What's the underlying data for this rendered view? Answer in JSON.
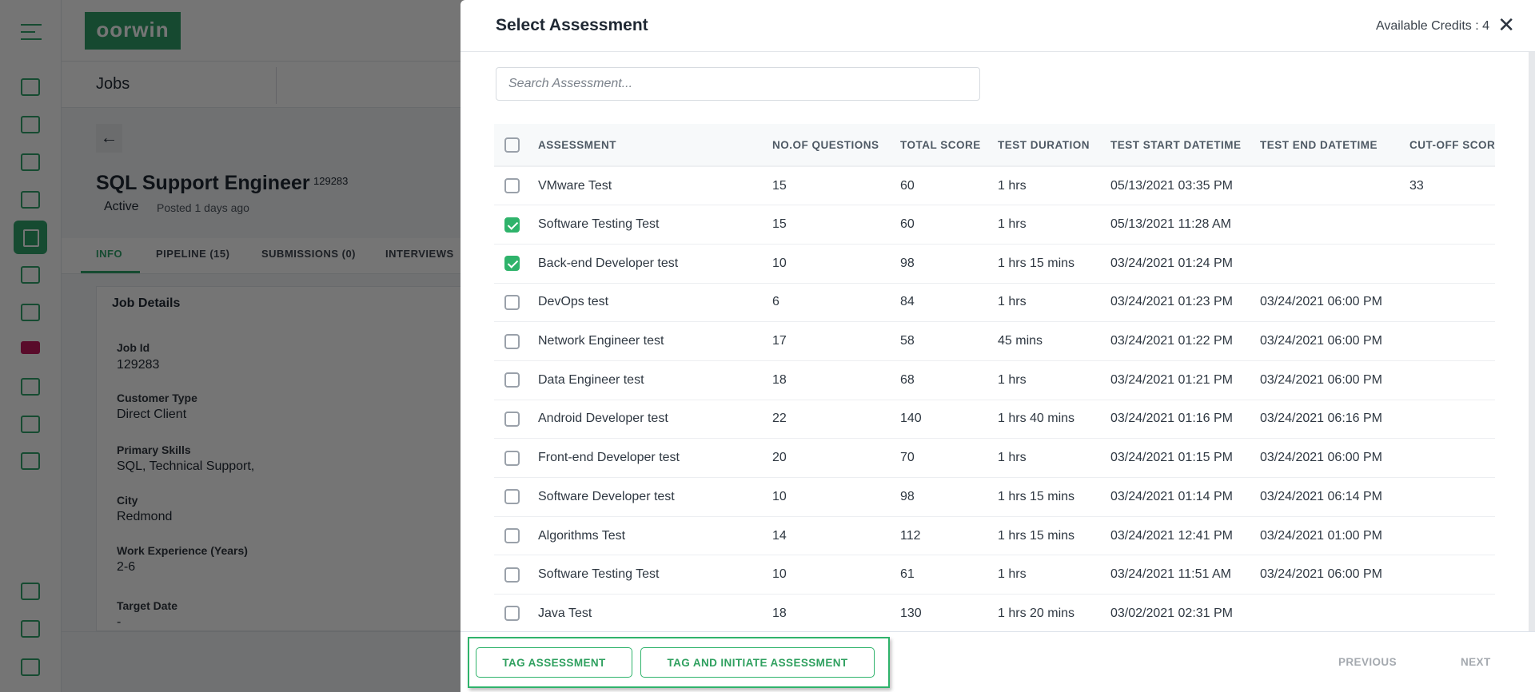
{
  "app": {
    "logo_text": "oorwin",
    "section_title": "Jobs"
  },
  "sidebar": {
    "icons": [
      "dashboard-icon",
      "contacts-icon",
      "calls-icon",
      "briefcase-icon",
      "jobs-icon",
      "candidates-icon",
      "submissions-icon",
      "beta-icon",
      "reports-icon",
      "workflow-icon",
      "documents-icon"
    ],
    "bottom_icons": [
      "settings-sliders-icon",
      "headset-icon",
      "help-icon"
    ],
    "active": "jobs-icon",
    "accent": "#2fa36b"
  },
  "job": {
    "title": "SQL Support Engineer",
    "id": "129283",
    "status": "Active",
    "posted": "Posted 1 days ago",
    "tabs": [
      "INFO",
      "PIPELINE (15)",
      "SUBMISSIONS (0)",
      "INTERVIEWS"
    ],
    "card_title": "Job Details",
    "fields": [
      {
        "label": "Job Id",
        "value": "129283"
      },
      {
        "label": "Customer Type",
        "value": "Direct Client"
      },
      {
        "label": "Primary Skills",
        "value": "SQL, Technical Support,"
      },
      {
        "label": "City",
        "value": "Redmond"
      },
      {
        "label": "Work Experience (Years)",
        "value": "2-6"
      },
      {
        "label": "Target Date",
        "value": "-"
      }
    ]
  },
  "modal": {
    "title": "Select Assessment",
    "credits": "Available Credits : 4",
    "search_placeholder": "Search Assessment...",
    "columns": [
      "ASSESSMENT",
      "NO.OF QUESTIONS",
      "TOTAL SCORE",
      "TEST DURATION",
      "TEST START DATETIME",
      "TEST END DATETIME",
      "CUT-OFF SCORE"
    ],
    "rows": [
      {
        "checked": false,
        "name": "VMware Test",
        "questions": "15",
        "score": "60",
        "duration": "1 hrs",
        "start": "05/13/2021 03:35 PM",
        "end": "",
        "cutoff": "33"
      },
      {
        "checked": true,
        "name": "Software Testing Test",
        "questions": "15",
        "score": "60",
        "duration": "1 hrs",
        "start": "05/13/2021 11:28 AM",
        "end": "",
        "cutoff": ""
      },
      {
        "checked": true,
        "name": "Back-end Developer test",
        "questions": "10",
        "score": "98",
        "duration": "1 hrs 15 mins",
        "start": "03/24/2021 01:24 PM",
        "end": "",
        "cutoff": ""
      },
      {
        "checked": false,
        "name": "DevOps test",
        "questions": "6",
        "score": "84",
        "duration": "1 hrs",
        "start": "03/24/2021 01:23 PM",
        "end": "03/24/2021 06:00 PM",
        "cutoff": ""
      },
      {
        "checked": false,
        "name": "Network Engineer test",
        "questions": "17",
        "score": "58",
        "duration": "45 mins",
        "start": "03/24/2021 01:22 PM",
        "end": "03/24/2021 06:00 PM",
        "cutoff": ""
      },
      {
        "checked": false,
        "name": "Data Engineer test",
        "questions": "18",
        "score": "68",
        "duration": "1 hrs",
        "start": "03/24/2021 01:21 PM",
        "end": "03/24/2021 06:00 PM",
        "cutoff": ""
      },
      {
        "checked": false,
        "name": "Android Developer test",
        "questions": "22",
        "score": "140",
        "duration": "1 hrs 40 mins",
        "start": "03/24/2021 01:16 PM",
        "end": "03/24/2021 06:16 PM",
        "cutoff": ""
      },
      {
        "checked": false,
        "name": "Front-end Developer test",
        "questions": "20",
        "score": "70",
        "duration": "1 hrs",
        "start": "03/24/2021 01:15 PM",
        "end": "03/24/2021 06:00 PM",
        "cutoff": ""
      },
      {
        "checked": false,
        "name": "Software Developer test",
        "questions": "10",
        "score": "98",
        "duration": "1 hrs 15 mins",
        "start": "03/24/2021 01:14 PM",
        "end": "03/24/2021 06:14 PM",
        "cutoff": ""
      },
      {
        "checked": false,
        "name": "Algorithms Test",
        "questions": "14",
        "score": "112",
        "duration": "1 hrs 15 mins",
        "start": "03/24/2021 12:41 PM",
        "end": "03/24/2021 01:00 PM",
        "cutoff": ""
      },
      {
        "checked": false,
        "name": "Software Testing Test",
        "questions": "10",
        "score": "61",
        "duration": "1 hrs",
        "start": "03/24/2021 11:51 AM",
        "end": "03/24/2021 06:00 PM",
        "cutoff": ""
      },
      {
        "checked": false,
        "name": "Java Test",
        "questions": "18",
        "score": "130",
        "duration": "1 hrs 20 mins",
        "start": "03/02/2021 02:31 PM",
        "end": "",
        "cutoff": ""
      }
    ],
    "footer": {
      "tag": "TAG ASSESSMENT",
      "tag_initiate": "TAG AND INITIATE ASSESSMENT",
      "previous": "PREVIOUS",
      "next": "NEXT"
    },
    "accent": "#2fb36b"
  }
}
